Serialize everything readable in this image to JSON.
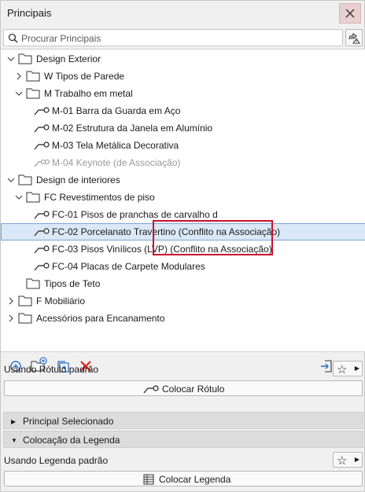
{
  "window": {
    "title": "Principais"
  },
  "search": {
    "placeholder": "Procurar Principais"
  },
  "tree": [
    {
      "label": "Design Exterior"
    },
    {
      "label": "W Tipos de Parede"
    },
    {
      "label": "M Trabalho em metal"
    },
    {
      "label": "M-01 Barra da Guarda em Aço"
    },
    {
      "label": "M-02 Estrutura da Janela em Alumínio"
    },
    {
      "label": "M-03 Tela Metálica Decorativa"
    },
    {
      "label": "M-04 Keynote (de Associação)"
    },
    {
      "label": "Design de interiores"
    },
    {
      "label": "FC Revestimentos de piso"
    },
    {
      "label": "FC-01 Pisos de pranchas de carvalho d"
    },
    {
      "label": "FC-02 Porcelanato Travertino (Conflito na Associação)"
    },
    {
      "label": "FC-03 Pisos Vinílicos (LVP) (Conflito na Associação)"
    },
    {
      "label": "FC-04 Placas de Carpete Modulares"
    },
    {
      "label": "Tipos de Teto"
    },
    {
      "label": "F Mobiliário"
    },
    {
      "label": "Acessórios para Encanamento"
    }
  ],
  "label_section": {
    "status": "Usando Rótulo padrão",
    "button": "Colocar Rótulo"
  },
  "accordions": {
    "selected": "Principal Selecionado",
    "legend": "Colocação da Legenda"
  },
  "legend_section": {
    "status": "Usando Legenda padrão",
    "button": "Colocar Legenda"
  },
  "colors": {
    "selection": "#dbe8f7",
    "callout": "#c8102e",
    "accent_blue": "#2f6fc0",
    "delete_red": "#d9231d"
  }
}
